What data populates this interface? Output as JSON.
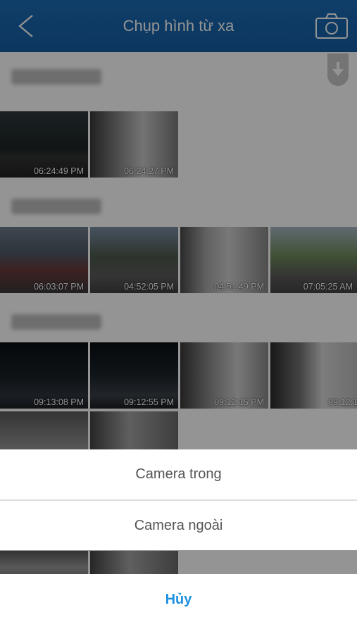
{
  "header": {
    "title": "Chụp hình từ xa"
  },
  "sections": [
    {
      "date": "2018-04-03",
      "photos": [
        {
          "time": "06:24:49 PM",
          "bg": "linear-gradient(#2d3a3c 0%,#1e2526 55%,#333 70%,#222 100%)"
        },
        {
          "time": "06:24:27 PM",
          "bg": "linear-gradient(90deg,#3a3a3a,#9a9a9a 40%,#c8c8c8 60%,#7a7a7a)"
        }
      ]
    },
    {
      "date": "2018-03-30",
      "photos": [
        {
          "time": "06:03:07 PM",
          "bg": "linear-gradient(#6d7a8a 0%,#505a66 40%,#6a3a3a 65%,#3a3a3a 100%)"
        },
        {
          "time": "04:52:05 PM",
          "bg": "linear-gradient(#7c8fa6 0%,#4d5a4d 45%,#5b5b5b 75%,#3f3f3f 100%)"
        },
        {
          "time": "04:51:49 PM",
          "bg": "linear-gradient(90deg,#4a4a4a,#a9a9a9 30%,#d0d0d0 55%,#888 100%)"
        },
        {
          "time": "07:05:25 AM",
          "bg": "linear-gradient(#a7b7c4 0%,#6f8a5a 45%,#5a5a5a 75%,#444 100%)"
        }
      ]
    },
    {
      "date": "2018-03-29",
      "photos": [
        {
          "time": "09:13:08 PM",
          "bg": "linear-gradient(#0b0f14 0%,#1a2228 55%,#2f3640 80%,#1c1f22 100%)"
        },
        {
          "time": "09:12:55 PM",
          "bg": "linear-gradient(#0b0f14 0%,#1c242a 50%,#3a4048 80%,#1a1d20 100%)"
        },
        {
          "time": "09:12:15 PM",
          "bg": "linear-gradient(90deg,#3a3a3a,#9c9c9c 40%,#cfcfcf 65%,#8a8a8a)"
        },
        {
          "time": "09:12:16 PM",
          "bg": "linear-gradient(90deg,#2a2a2a,#777 35%,#d8d8d8 60%,#bbb 100%)"
        }
      ]
    },
    {
      "date": "",
      "photos": [
        {
          "time": "",
          "bg": "linear-gradient(#5a5a5a,#9a9a9a 60%,#777)"
        },
        {
          "time": "",
          "bg": "linear-gradient(90deg,#444,#a5a5a5 45%,#6a6a6a)"
        }
      ]
    }
  ],
  "sheet": {
    "option1": "Camera trong",
    "option2": "Camera ngoài",
    "cancel": "Hủy"
  },
  "colors": {
    "header": "#1b6cb4",
    "accent": "#1e90e0"
  }
}
